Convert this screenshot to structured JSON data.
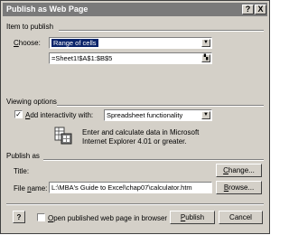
{
  "window": {
    "title": "Publish as Web Page",
    "help_icon": "?",
    "close_icon": "X"
  },
  "item_section": {
    "heading": "Item to publish",
    "choose_label": "Choose:",
    "choose_value": "Range of cells",
    "range_value": "=Sheet1!$A$1:$B$5",
    "collapse_icon": "collapse-dialog-icon"
  },
  "viewing_section": {
    "heading": "Viewing options",
    "interactivity_label": "Add interactivity with:",
    "interactivity_checked": true,
    "interactivity_value": "Spreadsheet functionality",
    "info_text_1": "Enter and calculate data in Microsoft",
    "info_text_2": "Internet Explorer 4.01 or greater.",
    "info_icon": "spreadsheet-calculator-icon"
  },
  "publish_section": {
    "heading": "Publish as",
    "title_label": "Title:",
    "title_value": "",
    "change_button": "Change...",
    "filename_label": "File name:",
    "filename_value": "L:\\MBA's Guide to Excel\\chap07\\calculator.htm",
    "browse_button": "Browse..."
  },
  "footer": {
    "help_icon": "?",
    "open_in_browser_label": "Open published web page in browser",
    "open_in_browser_checked": false,
    "publish_button": "Publish",
    "cancel_button": "Cancel"
  }
}
